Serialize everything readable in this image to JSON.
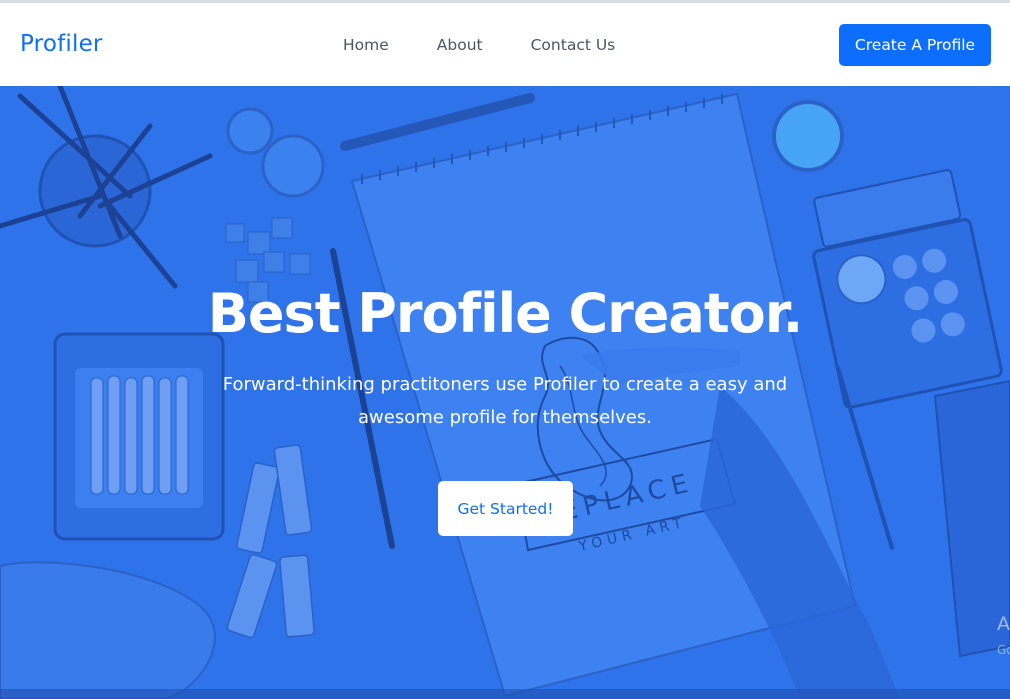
{
  "navbar": {
    "brand": "Profiler",
    "links": [
      {
        "label": "Home"
      },
      {
        "label": "About"
      },
      {
        "label": "Contact Us"
      }
    ],
    "cta_label": "Create A Profile"
  },
  "hero": {
    "title": "Best Profile Creator.",
    "subtitle": "Forward-thinking practitoners use Profiler to create a easy and awesome profile for themselves.",
    "button_label": "Get Started!",
    "background_text_1": "REPLACE",
    "background_text_2": "YOUR ART",
    "edge_text_1": "A",
    "edge_text_2": "Go"
  },
  "colors": {
    "brand_blue": "#0d6efd",
    "hero_overlay": "#2f73ea",
    "nav_text": "#4a5566"
  }
}
